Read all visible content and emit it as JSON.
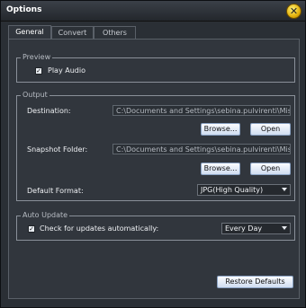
{
  "window": {
    "title": "Options"
  },
  "tabs": [
    {
      "label": "General",
      "active": true
    },
    {
      "label": "Convert",
      "active": false
    },
    {
      "label": "Others",
      "active": false
    }
  ],
  "preview": {
    "legend": "Preview",
    "play_audio": {
      "label": "Play Audio",
      "checked": true
    }
  },
  "output": {
    "legend": "Output",
    "destination": {
      "label": "Destination:",
      "value": "C:\\Documents and Settings\\sebina.pulvirenti\\Mis documen"
    },
    "snapshot": {
      "label": "Snapshot Folder:",
      "value": "C:\\Documents and Settings\\sebina.pulvirenti\\Mis documen"
    },
    "browse_label": "Browse...",
    "open_label": "Open",
    "default_format": {
      "label": "Default Format:",
      "value": "JPG(High Quality)"
    }
  },
  "auto_update": {
    "legend": "Auto Update",
    "check": {
      "label": "Check for updates automatically:",
      "checked": true
    },
    "frequency": "Every Day"
  },
  "restore_defaults_label": "Restore Defaults"
}
